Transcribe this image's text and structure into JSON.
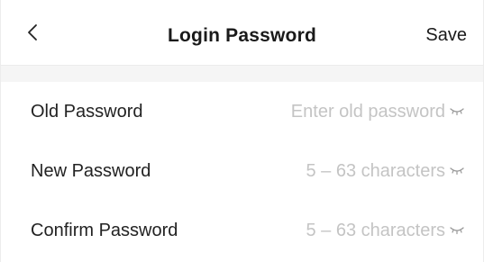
{
  "header": {
    "back_icon": "chevron-left-icon",
    "title": "Login Password",
    "save_label": "Save"
  },
  "form": {
    "rows": [
      {
        "label": "Old Password",
        "placeholder": "Enter old password",
        "value": "",
        "toggle_icon": "eye-closed-icon"
      },
      {
        "label": "New Password",
        "placeholder": "5 – 63 characters",
        "value": "",
        "toggle_icon": "eye-closed-icon"
      },
      {
        "label": "Confirm Password",
        "placeholder": "5 – 63 characters",
        "value": "",
        "toggle_icon": "eye-closed-icon"
      }
    ]
  },
  "colors": {
    "text": "#1f1f1f",
    "placeholder": "#c4c4c4",
    "band": "#f5f5f5",
    "border": "#ececec",
    "background": "#ffffff"
  }
}
